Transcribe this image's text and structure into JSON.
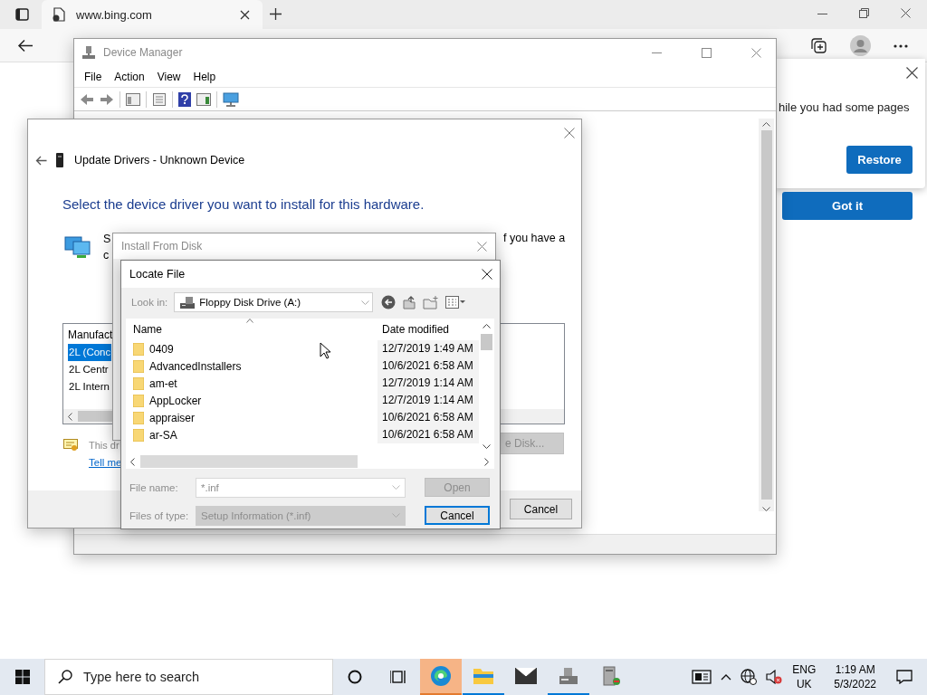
{
  "browser": {
    "tab": {
      "title": "www.bing.com"
    },
    "restore_popup": {
      "message": "hile you had some pages",
      "restore_button": "Restore"
    },
    "got_it_button": "Got it"
  },
  "device_manager": {
    "title": "Device Manager",
    "menu": [
      "File",
      "Action",
      "View",
      "Help"
    ]
  },
  "update_drivers": {
    "title": "Update Drivers - Unknown Device",
    "heading": "Select the device driver you want to install for this hardware.",
    "intro_left": [
      "S",
      "c"
    ],
    "intro_right": "f you have a",
    "list": {
      "header": "Manufact",
      "items": [
        {
          "label": "2L (Conc",
          "selected": true
        },
        {
          "label": "2L Centr",
          "selected": false
        },
        {
          "label": "2L Intern",
          "selected": false
        }
      ]
    },
    "note": "This dr",
    "link": "Tell me",
    "have_disk_button": {
      "label": "e Disk...",
      "disabled": true
    },
    "cancel_button": "Cancel"
  },
  "install_from_disk": {
    "title": "Install From Disk"
  },
  "locate_file": {
    "title": "Locate File",
    "look_in_label": "Look in:",
    "look_in_value": "Floppy Disk Drive (A:)",
    "columns": [
      "Name",
      "Date modified"
    ],
    "rows": [
      {
        "name": "0409",
        "date": "12/7/2019 1:49 AM"
      },
      {
        "name": "AdvancedInstallers",
        "date": "10/6/2021 6:58 AM"
      },
      {
        "name": "am-et",
        "date": "12/7/2019 1:14 AM"
      },
      {
        "name": "AppLocker",
        "date": "12/7/2019 1:14 AM"
      },
      {
        "name": "appraiser",
        "date": "10/6/2021 6:58 AM"
      },
      {
        "name": "ar-SA",
        "date": "10/6/2021 6:58 AM"
      }
    ],
    "file_name_label": "File name:",
    "file_name_value": "*.inf",
    "files_of_type_label": "Files of type:",
    "files_of_type_value": "Setup Information (*.inf)",
    "open_button": {
      "label": "Open",
      "disabled": true
    },
    "cancel_button": "Cancel"
  },
  "taskbar": {
    "search_placeholder": "Type here to search",
    "apps": [
      {
        "kind": "edge",
        "selected": true,
        "open": true
      },
      {
        "kind": "explorer",
        "selected": false,
        "open": true
      },
      {
        "kind": "mail",
        "selected": false,
        "open": false
      },
      {
        "kind": "scanner",
        "selected": false,
        "open": true
      },
      {
        "kind": "setup",
        "selected": false,
        "open": false
      }
    ],
    "language": "ENG",
    "region": "UK",
    "time": "1:19 AM",
    "date": "5/3/2022"
  }
}
